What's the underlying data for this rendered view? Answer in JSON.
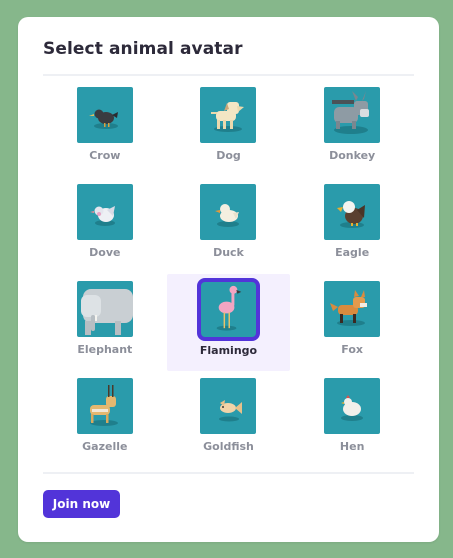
{
  "dialog": {
    "title": "Select animal avatar",
    "join_label": "Join now",
    "accent_color": "#5234d9",
    "tile_color": "#2a9bab"
  },
  "avatars": [
    {
      "label": "Crow",
      "icon": "crow-icon",
      "selected": false
    },
    {
      "label": "Dog",
      "icon": "dog-icon",
      "selected": false
    },
    {
      "label": "Donkey",
      "icon": "donkey-icon",
      "selected": false
    },
    {
      "label": "Dove",
      "icon": "dove-icon",
      "selected": false
    },
    {
      "label": "Duck",
      "icon": "duck-icon",
      "selected": false
    },
    {
      "label": "Eagle",
      "icon": "eagle-icon",
      "selected": false
    },
    {
      "label": "Elephant",
      "icon": "elephant-icon",
      "selected": false
    },
    {
      "label": "Flamingo",
      "icon": "flamingo-icon",
      "selected": true
    },
    {
      "label": "Fox",
      "icon": "fox-icon",
      "selected": false
    },
    {
      "label": "Gazelle",
      "icon": "gazelle-icon",
      "selected": false
    },
    {
      "label": "Goldfish",
      "icon": "goldfish-icon",
      "selected": false
    },
    {
      "label": "Hen",
      "icon": "hen-icon",
      "selected": false
    }
  ]
}
